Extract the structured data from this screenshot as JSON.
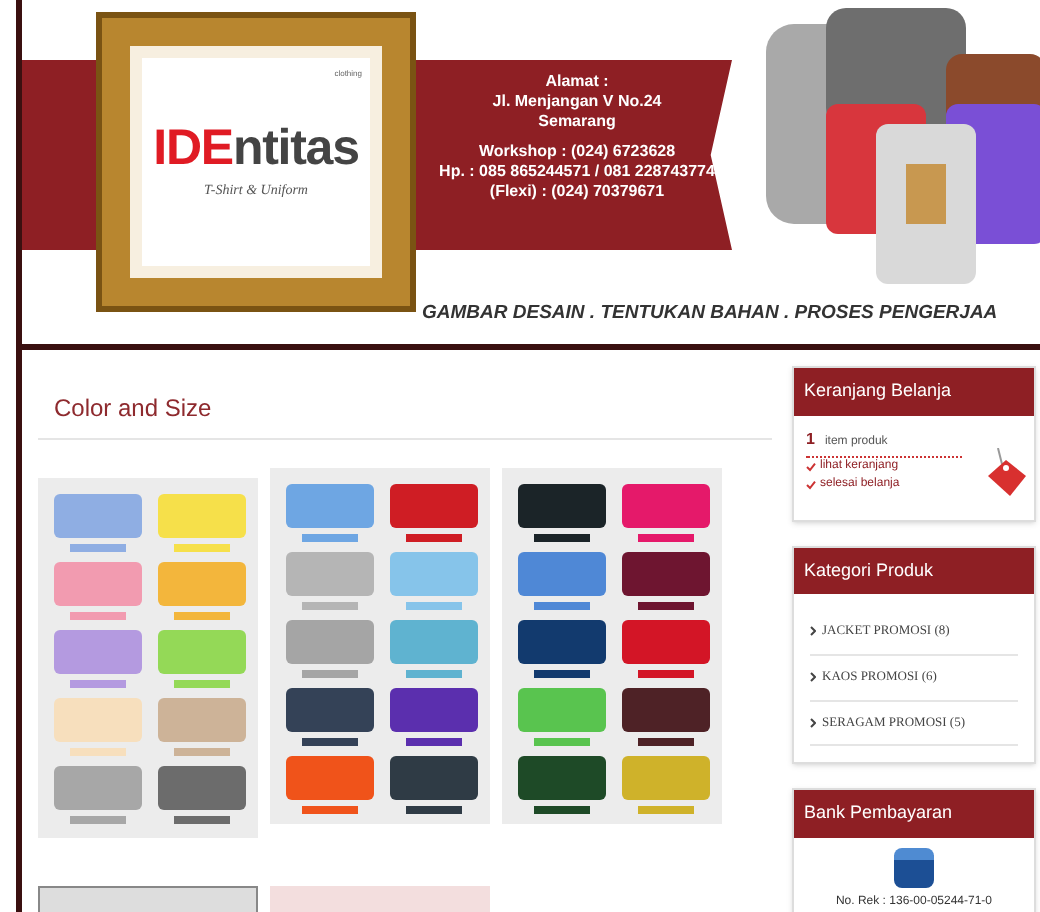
{
  "header": {
    "logo": {
      "brand_red": "IDE",
      "brand_rest": "ntitas",
      "badge": "clothing",
      "tagline": "T-Shirt & Uniform"
    },
    "address": {
      "label": "Alamat :",
      "street": "Jl. Menjangan V No.24",
      "city": "Semarang",
      "workshop": "Workshop : (024) 6723628",
      "hp": "Hp. : 085 865244571 / 081 228743774",
      "flexi": "(Flexi) : (024) 70379671"
    },
    "slogan": "GAMBAR DESAIN . TENTUKAN BAHAN . PROSES PENGERJAA"
  },
  "content": {
    "title": "Color and Size"
  },
  "sidebar": [
    {
      "kind": "cart",
      "title": "Keranjang Belanja",
      "count": "1",
      "count_label": "item produk",
      "links": [
        "lihat keranjang",
        "selesai belanja"
      ]
    },
    {
      "kind": "categories",
      "title": "Kategori Produk",
      "items": [
        "JACKET PROMOSI (8)",
        "KAOS PROMOSI (6)",
        "SERAGAM PROMOSI (5)"
      ]
    },
    {
      "kind": "bank",
      "title": "Bank Pembayaran",
      "account": "No. Rek : 136-00-05244-71-0"
    }
  ]
}
